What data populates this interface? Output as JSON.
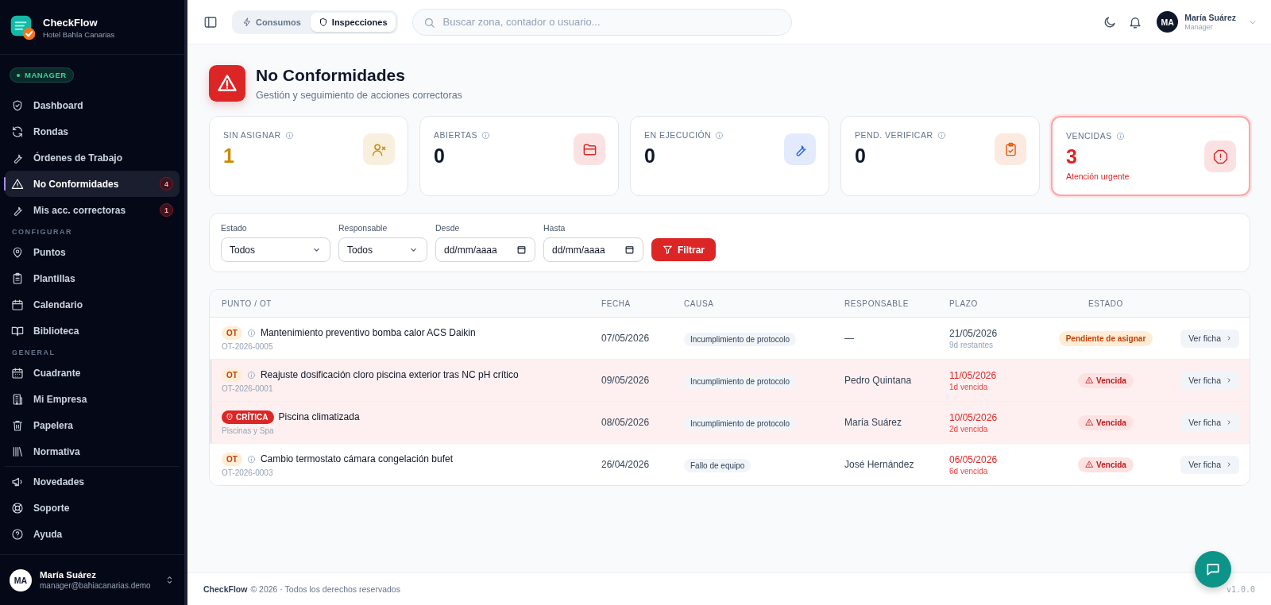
{
  "sidebar": {
    "brand": {
      "name": "CheckFlow",
      "subtitle": "Hotel Bahía Canarias"
    },
    "role": "MANAGER",
    "sections": [
      {
        "items": [
          {
            "label": "Dashboard",
            "selected": false
          },
          {
            "label": "Rondas",
            "selected": false
          },
          {
            "label": "Órdenes de Trabajo",
            "selected": false
          },
          {
            "label": "No Conformidades",
            "selected": true,
            "badge": "4"
          },
          {
            "label": "Mis acc. correctoras",
            "selected": false,
            "badge": "1"
          }
        ]
      },
      {
        "heading": "CONFIGURAR",
        "items": [
          {
            "label": "Puntos",
            "selected": false
          },
          {
            "label": "Plantillas",
            "selected": false
          },
          {
            "label": "Calendario",
            "selected": false
          },
          {
            "label": "Biblioteca",
            "selected": false
          }
        ]
      },
      {
        "heading": "GENERAL",
        "items": [
          {
            "label": "Cuadrante",
            "selected": false
          },
          {
            "label": "Mi Empresa",
            "selected": false
          },
          {
            "label": "Papelera",
            "selected": false
          },
          {
            "label": "Normativa",
            "selected": false
          }
        ]
      },
      {
        "items": [
          {
            "label": "Novedades",
            "selected": false
          },
          {
            "label": "Soporte",
            "selected": false
          },
          {
            "label": "Ayuda",
            "selected": false
          }
        ]
      }
    ],
    "user": {
      "initials": "MA",
      "name": "María Suárez",
      "email": "manager@bahiacanarias.demo"
    }
  },
  "topbar": {
    "tabs": [
      {
        "label": "Consumos",
        "selected": false
      },
      {
        "label": "Inspecciones",
        "selected": true
      }
    ],
    "search": {
      "placeholder": "Buscar zona, contador o usuario..."
    },
    "user": {
      "initials": "MA",
      "name": "María Suárez",
      "role": "Manager"
    }
  },
  "page": {
    "title": "No Conformidades",
    "subtitle": "Gestión y seguimiento de acciones correctoras"
  },
  "stats": [
    {
      "label": "SIN ASIGNAR",
      "value": "1",
      "color": "#ca8a04",
      "highlight": true,
      "alert": false
    },
    {
      "label": "ABIERTAS",
      "value": "0",
      "color": "#dc2626",
      "highlight": false,
      "alert": false
    },
    {
      "label": "EN EJECUCIÓN",
      "value": "0",
      "color": "#2563eb",
      "highlight": false,
      "alert": false
    },
    {
      "label": "PEND. VERIFICAR",
      "value": "0",
      "color": "#ea580c",
      "highlight": false,
      "alert": false
    },
    {
      "label": "VENCIDAS",
      "value": "3",
      "color": "#dc2626",
      "highlight": true,
      "alert": true,
      "note": "Atención urgente"
    }
  ],
  "filters": {
    "fields": [
      {
        "kind": "select",
        "label": "Estado",
        "value": "Todos"
      },
      {
        "kind": "select",
        "label": "Responsable",
        "value": "Todos"
      },
      {
        "kind": "date",
        "label": "Desde",
        "placeholder": "dd/mm/aaaa"
      },
      {
        "kind": "date",
        "label": "Hasta",
        "placeholder": "dd/mm/aaaa"
      }
    ],
    "button": "Filtrar"
  },
  "table": {
    "columns": [
      "PUNTO / OT",
      "FECHA",
      "CAUSA",
      "RESPONSABLE",
      "PLAZO",
      "ESTADO"
    ],
    "rows": [
      {
        "tag": {
          "kind": "ot",
          "label": "OT"
        },
        "title": "Mantenimiento preventivo bomba calor ACS Daikin",
        "code": "OT-2026-0005",
        "fecha": "07/05/2026",
        "causa": "Incumplimiento de protocolo",
        "responsable": "—",
        "plazo": "21/05/2026",
        "plazo_note": "9d restantes",
        "overdue": false,
        "estado": {
          "kind": "pending",
          "label": "Pendiente de asignar"
        },
        "action": "Ver ficha"
      },
      {
        "tag": {
          "kind": "ot",
          "label": "OT"
        },
        "title": "Reajuste dosificación cloro piscina exterior tras NC pH crítico",
        "code": "OT-2026-0001",
        "fecha": "09/05/2026",
        "causa": "Incumplimiento de protocolo",
        "responsable": "Pedro Quintana",
        "plazo": "11/05/2026",
        "plazo_note": "1d vencida",
        "overdue": true,
        "estado": {
          "kind": "overdue",
          "label": "Vencida"
        },
        "action": "Ver ficha"
      },
      {
        "tag": {
          "kind": "critical",
          "label": "CRÍTICA"
        },
        "title": "Piscina climatizada",
        "code": "Piscinas y Spa",
        "fecha": "08/05/2026",
        "causa": "Incumplimiento de protocolo",
        "responsable": "María Suárez",
        "plazo": "10/05/2026",
        "plazo_note": "2d vencida",
        "overdue": true,
        "estado": {
          "kind": "overdue",
          "label": "Vencida"
        },
        "action": "Ver ficha"
      },
      {
        "tag": {
          "kind": "ot",
          "label": "OT"
        },
        "title": "Cambio termostato cámara congelación bufet",
        "code": "OT-2026-0003",
        "fecha": "26/04/2026",
        "causa": "Fallo de equipo",
        "responsable": "José Hernández",
        "plazo": "06/05/2026",
        "plazo_note": "6d vencida",
        "overdue": false,
        "estado": {
          "kind": "overdue",
          "label": "Vencida"
        },
        "action": "Ver ficha"
      }
    ]
  },
  "footer": {
    "brand": "CheckFlow",
    "text": "© 2026 · Todos los derechos reservados",
    "version": "v1.0.0"
  }
}
